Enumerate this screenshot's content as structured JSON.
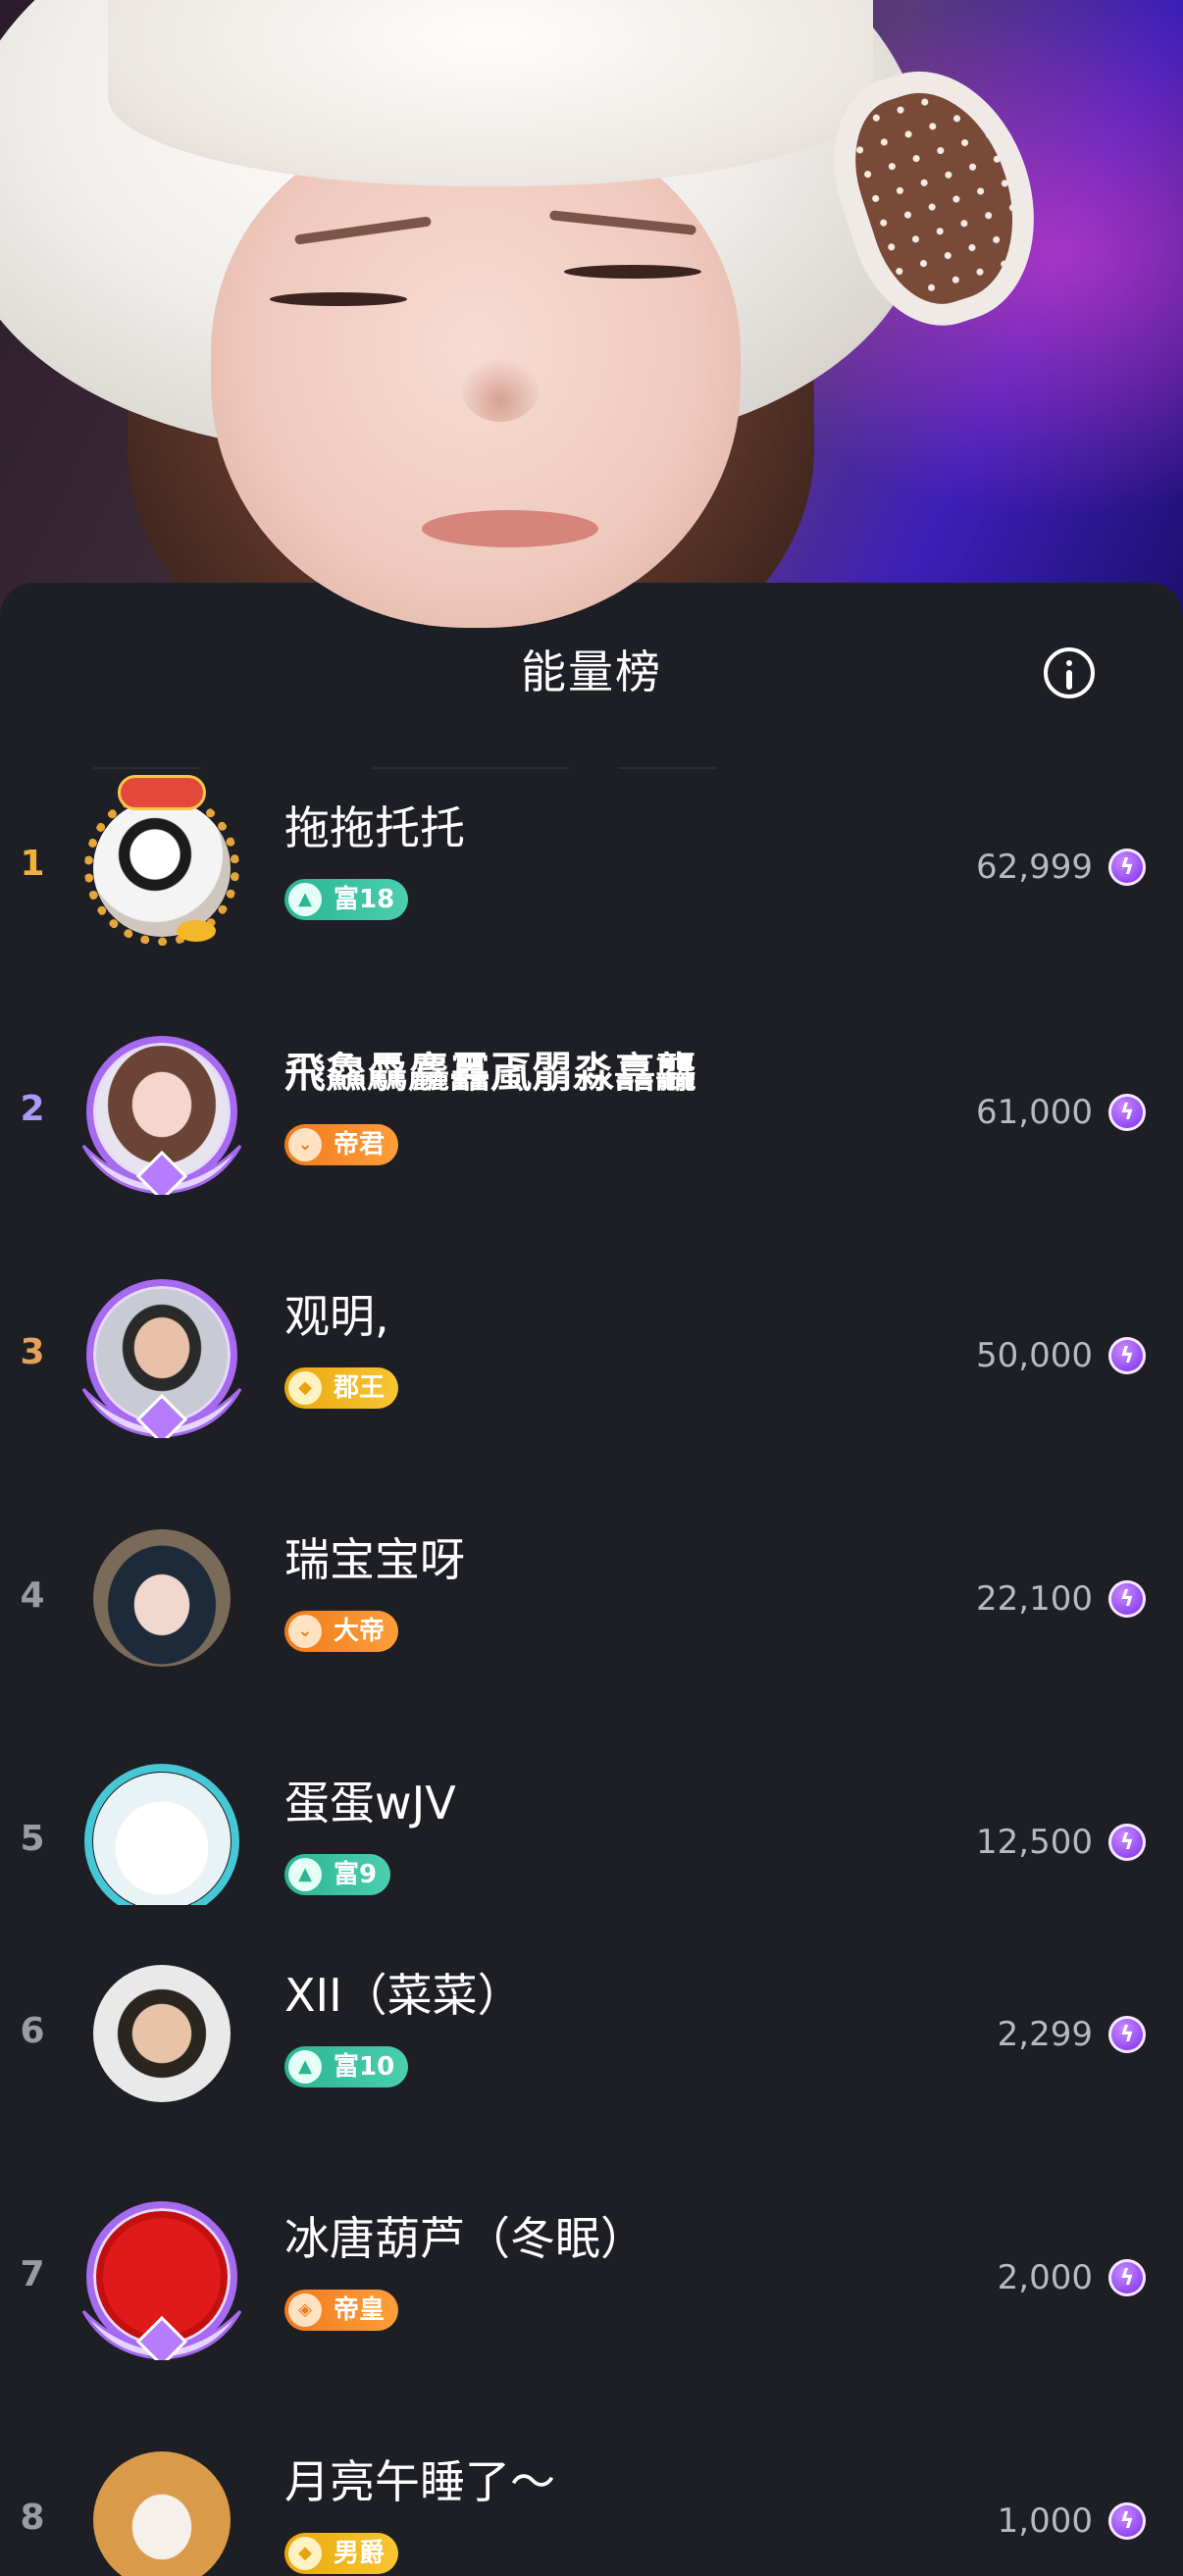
{
  "sheet": {
    "title": "能量榜"
  },
  "rows": [
    {
      "rank": "1",
      "name": "拖拖托托",
      "badge": "富18",
      "badge_style": "green",
      "score": "62,999"
    },
    {
      "rank": "2",
      "name": "飛鱻驫麤靐颪朤淼譶龘",
      "badge": "帝君",
      "badge_style": "orange",
      "score": "61,000"
    },
    {
      "rank": "3",
      "name": "观明,",
      "badge": "郡王",
      "badge_style": "gold",
      "score": "50,000"
    },
    {
      "rank": "4",
      "name": "瑞宝宝呀",
      "badge": "大帝",
      "badge_style": "orange",
      "score": "22,100"
    },
    {
      "rank": "5",
      "name": "蛋蛋wJV",
      "badge": "富9",
      "badge_style": "green",
      "score": "12,500"
    },
    {
      "rank": "6",
      "name": "XII（菜菜）",
      "badge": "富10",
      "badge_style": "green",
      "score": "2,299"
    },
    {
      "rank": "7",
      "name": "冰唐葫芦（冬眠）",
      "badge": "帝皇",
      "badge_style": "orange",
      "score": "2,000"
    },
    {
      "rank": "8",
      "name": "月亮午睡了～",
      "badge": "男爵",
      "badge_style": "gold",
      "score": "1,000"
    }
  ],
  "colors": {
    "background": "#1e1f24",
    "rank1": "#f2b23a",
    "rank2": "#a99af5",
    "rank3": "#e5a05c",
    "energy": "#8b3ff0"
  },
  "icons": {
    "info": "info-circle-icon",
    "energy": "lightning-bolt-icon"
  }
}
